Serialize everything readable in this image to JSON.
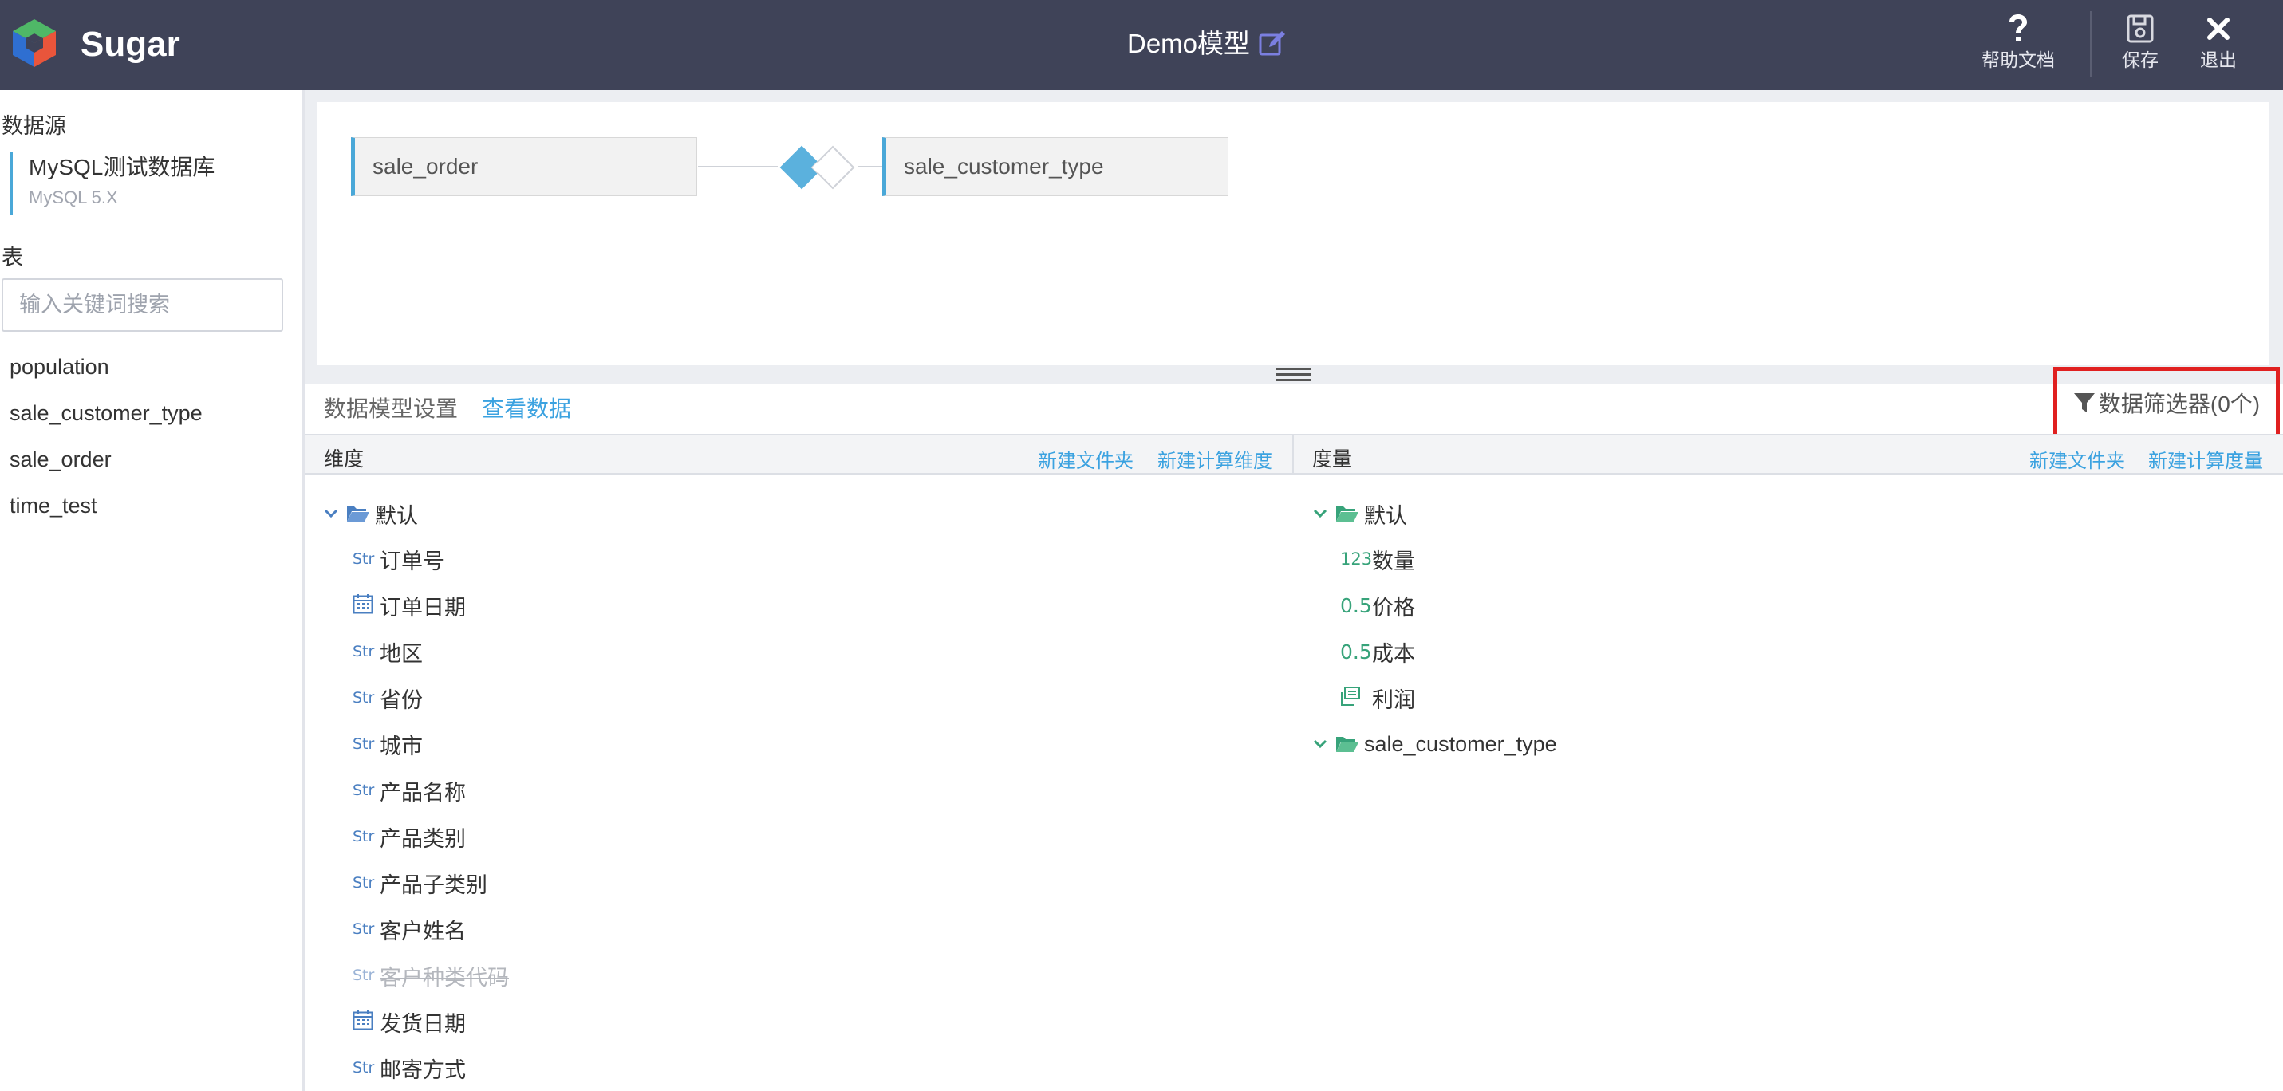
{
  "header": {
    "brand": "Sugar",
    "model_title": "Demo模型",
    "help_label": "帮助文档",
    "save_label": "保存",
    "exit_label": "退出"
  },
  "sidebar": {
    "datasource_title": "数据源",
    "datasource": {
      "name": "MySQL测试数据库",
      "type": "MySQL 5.X"
    },
    "tables_title": "表",
    "search_placeholder": "输入关键词搜索",
    "tables": [
      "population",
      "sale_customer_type",
      "sale_order",
      "time_test"
    ]
  },
  "canvas": {
    "left_table": "sale_order",
    "right_table": "sale_customer_type"
  },
  "tabs": {
    "settings": "数据模型设置",
    "view_data": "查看数据",
    "filter": "数据筛选器(0个)"
  },
  "dimensions": {
    "title": "维度",
    "new_folder": "新建文件夹",
    "new_calc": "新建计算维度",
    "folder": "默认",
    "type_str": "Str",
    "items": [
      {
        "type": "Str",
        "label": "订单号"
      },
      {
        "type": "date",
        "label": "订单日期"
      },
      {
        "type": "Str",
        "label": "地区"
      },
      {
        "type": "Str",
        "label": "省份"
      },
      {
        "type": "Str",
        "label": "城市"
      },
      {
        "type": "Str",
        "label": "产品名称"
      },
      {
        "type": "Str",
        "label": "产品类别"
      },
      {
        "type": "Str",
        "label": "产品子类别"
      },
      {
        "type": "Str",
        "label": "客户姓名"
      },
      {
        "type": "Str",
        "label": "客户种类代码",
        "disabled": true
      },
      {
        "type": "date",
        "label": "发货日期"
      },
      {
        "type": "Str",
        "label": "邮寄方式"
      }
    ]
  },
  "measures": {
    "title": "度量",
    "new_folder": "新建文件夹",
    "new_calc": "新建计算度量",
    "folder": "默认",
    "folder2": "sale_customer_type",
    "type_int": "123",
    "type_num": "0.5",
    "items": [
      {
        "type": "123",
        "label": "数量"
      },
      {
        "type": "0.5",
        "label": "价格"
      },
      {
        "type": "0.5",
        "label": "成本"
      },
      {
        "type": "calc",
        "label": "利润"
      }
    ]
  },
  "colors": {
    "header_bg": "#3f4358",
    "accent": "#3ba2e0",
    "join_blue": "#5bb1dd",
    "highlight_red": "#e02020"
  }
}
